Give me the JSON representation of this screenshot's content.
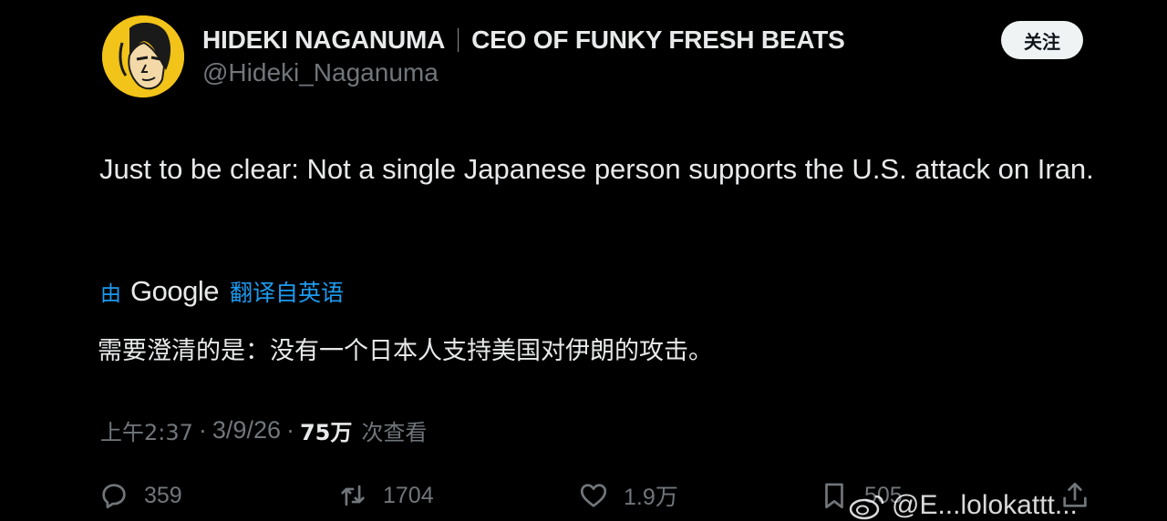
{
  "author": {
    "display_name": "HIDEKI NAGANUMA",
    "title": "CEO OF FUNKY FRESH BEATS",
    "handle": "@Hideki_Naganuma",
    "avatar_icon": "cartoon-portrait",
    "avatar_color": "#f2c318"
  },
  "follow_button": {
    "label": "关注"
  },
  "tweet": {
    "text": "Just to be clear: Not a single Japanese person supports the U.S. attack on Iran."
  },
  "translation": {
    "by_label": "由",
    "provider": "Google",
    "link_label": "翻译自英语",
    "translated_text": "需要澄清的是：没有一个日本人支持美国对伊朗的攻击。"
  },
  "meta": {
    "time": "上午2:37",
    "separator": "·",
    "date": "3/9/26",
    "views_count": "75万",
    "views_label": "次查看"
  },
  "actions": {
    "replies": "359",
    "retweets": "1704",
    "likes": "1.9万",
    "bookmarks": "505"
  },
  "watermark": {
    "text": "@E...lolokattt..."
  },
  "colors": {
    "background": "#000000",
    "text": "#e7e9ea",
    "muted": "#71767b",
    "link": "#1d9bf0"
  }
}
